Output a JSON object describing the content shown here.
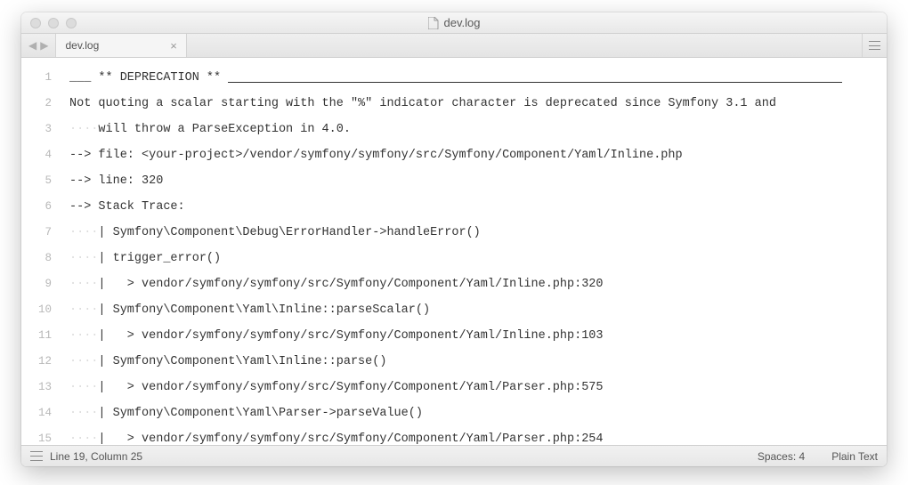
{
  "window": {
    "title": "dev.log"
  },
  "tabs": [
    {
      "label": "dev.log"
    }
  ],
  "lines": [
    {
      "n": 1,
      "lead_ws": "",
      "text": "___ ** DEPRECATION ** ",
      "hr_after": true
    },
    {
      "n": 2,
      "lead_ws": "",
      "text": "Not quoting a scalar starting with the \"%\" indicator character is deprecated since Symfony 3.1 and"
    },
    {
      "n": 3,
      "lead_ws": "....",
      "text": "will throw a ParseException in 4.0."
    },
    {
      "n": 4,
      "lead_ws": "",
      "text": "--> file: <your-project>/vendor/symfony/symfony/src/Symfony/Component/Yaml/Inline.php"
    },
    {
      "n": 5,
      "lead_ws": "",
      "text": "--> line: 320"
    },
    {
      "n": 6,
      "lead_ws": "",
      "text": "--> Stack Trace:"
    },
    {
      "n": 7,
      "lead_ws": "....",
      "text": "| Symfony\\Component\\Debug\\ErrorHandler->handleError()"
    },
    {
      "n": 8,
      "lead_ws": "....",
      "text": "| trigger_error()"
    },
    {
      "n": 9,
      "lead_ws": "....",
      "text": "|   > vendor/symfony/symfony/src/Symfony/Component/Yaml/Inline.php:320"
    },
    {
      "n": 10,
      "lead_ws": "....",
      "text": "| Symfony\\Component\\Yaml\\Inline::parseScalar()"
    },
    {
      "n": 11,
      "lead_ws": "....",
      "text": "|   > vendor/symfony/symfony/src/Symfony/Component/Yaml/Inline.php:103"
    },
    {
      "n": 12,
      "lead_ws": "....",
      "text": "| Symfony\\Component\\Yaml\\Inline::parse()"
    },
    {
      "n": 13,
      "lead_ws": "....",
      "text": "|   > vendor/symfony/symfony/src/Symfony/Component/Yaml/Parser.php:575"
    },
    {
      "n": 14,
      "lead_ws": "....",
      "text": "| Symfony\\Component\\Yaml\\Parser->parseValue()"
    },
    {
      "n": 15,
      "lead_ws": "....",
      "text": "|   > vendor/symfony/symfony/src/Symfony/Component/Yaml/Parser.php:254"
    }
  ],
  "status": {
    "cursor": "Line 19, Column 25",
    "spaces": "Spaces: 4",
    "syntax": "Plain Text"
  }
}
